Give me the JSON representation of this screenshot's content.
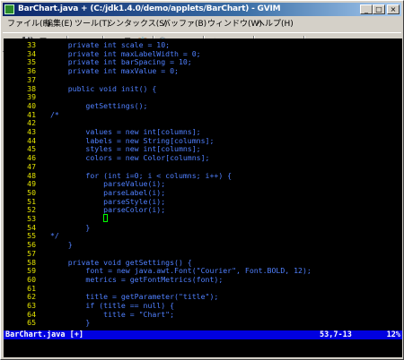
{
  "window": {
    "title": "BarChart.java + (C:/jdk1.4.0/demo/applets/BarChart) - GVIM",
    "buttons": {
      "minimize": "_",
      "maximize": "□",
      "close": "×"
    }
  },
  "menu": [
    "ファイル(F)",
    "編集(E)",
    "ツール(T)",
    "シンタックス(S)",
    "バッファ(B)",
    "ウィンドウ(W)",
    "ヘルプ(H)"
  ],
  "toolbar": [
    {
      "name": "open-icon",
      "glyph": "📂"
    },
    {
      "name": "save-icon",
      "glyph": "💾"
    },
    {
      "name": "save-all-icon",
      "glyph": "🗊"
    },
    {
      "name": "print-icon",
      "glyph": "🖶"
    },
    {
      "name": "undo-icon",
      "glyph": "↶"
    },
    {
      "name": "redo-icon",
      "glyph": "↷"
    },
    {
      "name": "cut-icon",
      "glyph": "✂"
    },
    {
      "name": "copy-icon",
      "glyph": "⎘"
    },
    {
      "name": "paste-icon",
      "glyph": "📋"
    },
    {
      "name": "find-icon",
      "glyph": "🔍"
    },
    {
      "name": "find-next-icon",
      "glyph": "⇥"
    },
    {
      "name": "find-prev-icon",
      "glyph": "⇤"
    },
    {
      "name": "load-session-icon",
      "glyph": "⬆"
    },
    {
      "name": "save-session-icon",
      "glyph": "⬇"
    },
    {
      "name": "run-script-icon",
      "glyph": "⚙"
    },
    {
      "name": "make-icon",
      "glyph": "⚒"
    },
    {
      "name": "shell-icon",
      "glyph": "▣"
    },
    {
      "name": "tags-icon",
      "glyph": "⌖"
    },
    {
      "name": "help-icon",
      "glyph": "?"
    },
    {
      "name": "find-help-icon",
      "glyph": "⚲"
    }
  ],
  "colors": {
    "line_number": "#e5e500",
    "keyword": "#5080ff",
    "status_bg": "#0000e0"
  },
  "editor": {
    "lines": [
      {
        "n": "33",
        "code": "    private int scale = 10;"
      },
      {
        "n": "34",
        "code": "    private int maxLabelWidth = 0;"
      },
      {
        "n": "35",
        "code": "    private int barSpacing = 10;"
      },
      {
        "n": "36",
        "code": "    private int maxValue = 0;"
      },
      {
        "n": "37",
        "code": ""
      },
      {
        "n": "38",
        "code": "    public void init() {"
      },
      {
        "n": "39",
        "code": ""
      },
      {
        "n": "40",
        "code": "        getSettings();"
      },
      {
        "n": "41",
        "code": "/*"
      },
      {
        "n": "42",
        "code": ""
      },
      {
        "n": "43",
        "code": "        values = new int[columns];"
      },
      {
        "n": "44",
        "code": "        labels = new String[columns];"
      },
      {
        "n": "45",
        "code": "        styles = new int[columns];"
      },
      {
        "n": "46",
        "code": "        colors = new Color[columns];"
      },
      {
        "n": "47",
        "code": ""
      },
      {
        "n": "48",
        "code": "        for (int i=0; i < columns; i++) {"
      },
      {
        "n": "49",
        "code": "            parseValue(i);"
      },
      {
        "n": "50",
        "code": "            parseLabel(i);"
      },
      {
        "n": "51",
        "code": "            parseStyle(i);"
      },
      {
        "n": "52",
        "code": "            parseColor(i);"
      },
      {
        "n": "53",
        "code": "            ",
        "cursor": true
      },
      {
        "n": "54",
        "code": "        }"
      },
      {
        "n": "55",
        "code": "*/"
      },
      {
        "n": "56",
        "code": "    }"
      },
      {
        "n": "57",
        "code": ""
      },
      {
        "n": "58",
        "code": "    private void getSettings() {"
      },
      {
        "n": "59",
        "code": "        font = new java.awt.Font(\"Courier\", Font.BOLD, 12);"
      },
      {
        "n": "60",
        "code": "        metrics = getFontMetrics(font);"
      },
      {
        "n": "61",
        "code": ""
      },
      {
        "n": "62",
        "code": "        title = getParameter(\"title\");"
      },
      {
        "n": "63",
        "code": "        if (title == null) {"
      },
      {
        "n": "64",
        "code": "            title = \"Chart\";"
      },
      {
        "n": "65",
        "code": "        }"
      }
    ]
  },
  "status": {
    "file": "BarChart.java [+]",
    "position": "53,7-13",
    "percent": "12%"
  }
}
